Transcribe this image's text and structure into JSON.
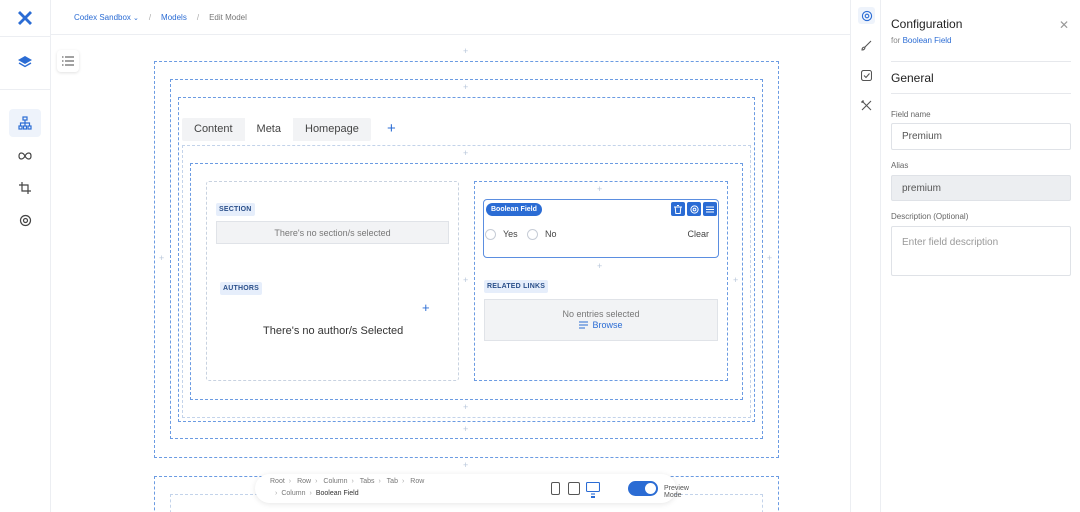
{
  "breadcrumb": {
    "items": [
      "Codex Sandbox",
      "Models",
      "Edit Model"
    ],
    "caret": "⌄",
    "separator": "/"
  },
  "tabs": {
    "items": [
      "Content",
      "Meta",
      "Homepage"
    ],
    "active": "Meta",
    "add": "+"
  },
  "left_column": {
    "section_tag": "SECTION",
    "section_empty": "There's no section/s selected",
    "authors_tag": "AUTHORS",
    "authors_empty": "There's no author/s Selected",
    "authors_add": "+"
  },
  "right_column": {
    "boolean_tag": "Boolean Field",
    "yes_label": "Yes",
    "no_label": "No",
    "clear_label": "Clear",
    "related_tag": "RELATED LINKS",
    "no_entries": "No entries selected",
    "browse": "Browse"
  },
  "bottom_bar": {
    "path_line1": [
      "Root",
      "Row",
      "Column",
      "Tabs",
      "Tab",
      "Row"
    ],
    "path_line2": [
      "Column",
      "Boolean Field"
    ],
    "preview_label": "Preview Mode",
    "preview_on": true
  },
  "config": {
    "title": "Configuration",
    "subtitle_prefix": "for",
    "subtitle_target": "Boolean Field",
    "close": "✕",
    "section": "General",
    "field_name_label": "Field name",
    "field_name_value": "Premium",
    "alias_label": "Alias",
    "alias_value": "premium",
    "description_label": "Description (Optional)",
    "description_placeholder": "Enter field description"
  },
  "colors": {
    "accent": "#2b6cd4",
    "dashed": "#6b9be2",
    "tag_bg": "#e6eefb"
  },
  "icons": {
    "left_rail": [
      "logo-icon",
      "layers-icon",
      "sitemap-icon",
      "infinity-icon",
      "crop-icon",
      "settings-icon"
    ],
    "config_rail": [
      "gear-icon",
      "brush-icon",
      "check-square-icon",
      "tools-icon"
    ]
  }
}
